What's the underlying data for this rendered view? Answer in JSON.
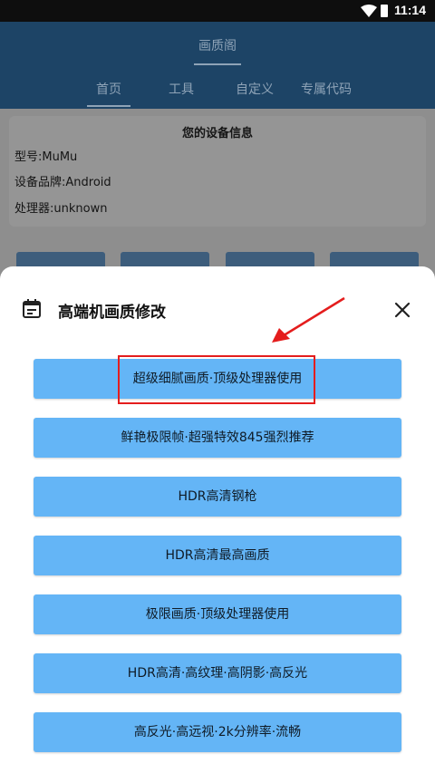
{
  "status_bar": {
    "time": "11:14"
  },
  "app_bar": {
    "title": "画质阁"
  },
  "tabs": [
    {
      "label": "首页"
    },
    {
      "label": "工具"
    },
    {
      "label": "自定义"
    },
    {
      "label": "专属代码"
    }
  ],
  "device_info": {
    "heading": "您的设备信息",
    "model": "型号:MuMu",
    "brand": "设备品牌:Android",
    "processor": "处理器:unknown"
  },
  "sheet": {
    "title": "高端机画质修改",
    "options": [
      {
        "label": "超级细腻画质·顶级处理器使用"
      },
      {
        "label": "鲜艳极限帧·超强特效845强烈推荐"
      },
      {
        "label": "HDR高清钢枪"
      },
      {
        "label": "HDR高清最高画质"
      },
      {
        "label": "极限画质·顶级处理器使用"
      },
      {
        "label": "HDR高清·高纹理·高阴影·高反光"
      },
      {
        "label": "高反光·高远视·2k分辨率·流畅"
      }
    ]
  },
  "colors": {
    "option_bg": "#64b5f6",
    "app_bar_dimmed": "#1d4466",
    "annotation_red": "#e41d1d"
  },
  "icons": {
    "sheet_icon": "calendar-icon",
    "close": "close-icon",
    "wifi": "wifi-icon",
    "battery": "battery-icon"
  }
}
